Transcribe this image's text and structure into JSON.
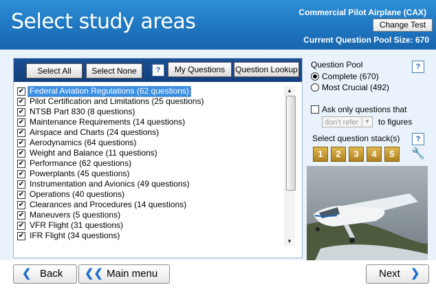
{
  "header": {
    "title": "Select study areas",
    "test_name": "Commercial Pilot Airplane (CAX)",
    "change_test_label": "Change Test",
    "pool_size": "Current Question Pool Size: 670"
  },
  "toolbar": {
    "select_all": "Select All",
    "select_none": "Select None",
    "help": "?",
    "my_questions": "My Questions",
    "question_lookup": "Question Lookup"
  },
  "areas": [
    {
      "label": "Federal Aviation Regulations (62 questions)",
      "checked": true,
      "selected": true
    },
    {
      "label": "Pilot Certification and Limitations (25 questions)",
      "checked": true
    },
    {
      "label": "NTSB Part 830 (8 questions)",
      "checked": true
    },
    {
      "label": "Maintenance Requirements (14 questions)",
      "checked": true
    },
    {
      "label": "Airspace and Charts (24 questions)",
      "checked": true
    },
    {
      "label": "Aerodynamics (64 questions)",
      "checked": true
    },
    {
      "label": "Weight and Balance (11 questions)",
      "checked": true
    },
    {
      "label": "Performance (62 questions)",
      "checked": true
    },
    {
      "label": "Powerplants (45 questions)",
      "checked": true
    },
    {
      "label": "Instrumentation and Avionics (49 questions)",
      "checked": true
    },
    {
      "label": "Operations (40 questions)",
      "checked": true
    },
    {
      "label": "Clearances and Procedures (14 questions)",
      "checked": true
    },
    {
      "label": "Maneuvers (5 questions)",
      "checked": true
    },
    {
      "label": "VFR Flight (31 questions)",
      "checked": true
    },
    {
      "label": "IFR Flight (34 questions)",
      "checked": true
    }
  ],
  "scroll_position": 0.0,
  "pool": {
    "heading": "Question Pool",
    "help": "?",
    "complete": "Complete (670)",
    "most_crucial": "Most Crucial (492)",
    "selected": "complete",
    "ask_only": "Ask only questions that",
    "dont_refer": "don't refer",
    "to_figures": "to figures"
  },
  "stacks": {
    "heading": "Select question stack(s)",
    "help": "?",
    "items": [
      "1",
      "2",
      "3",
      "4",
      "5"
    ]
  },
  "footer": {
    "back": "Back",
    "main_menu": "Main menu",
    "next": "Next"
  },
  "colors": {
    "header_blue": "#1f76c0",
    "toolbar_navy": "#1a4f94",
    "stack_gold": "#c89a35",
    "selection_blue": "#3b8fe3"
  }
}
